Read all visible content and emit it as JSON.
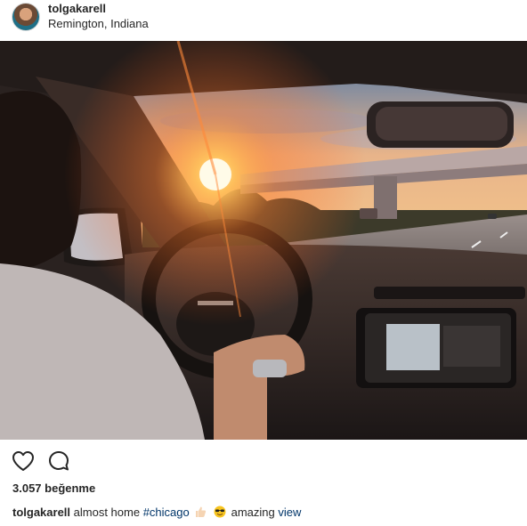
{
  "post": {
    "username": "tolgakarell",
    "location": "Remington, Indiana",
    "likes": "3.057 beğenme",
    "caption": {
      "user": "tolgakarell",
      "text_before": "almost home",
      "hashtag": "#chicago",
      "emojis": [
        "thumbs-up",
        "smiling-face-with-sunglasses"
      ],
      "text_after": "amazing",
      "link": "view"
    }
  },
  "icons": {
    "like": "heart-icon",
    "comment": "comment-icon"
  },
  "colors": {
    "text": "#262626",
    "hashtag": "#003569",
    "sun": "#ffb347"
  }
}
